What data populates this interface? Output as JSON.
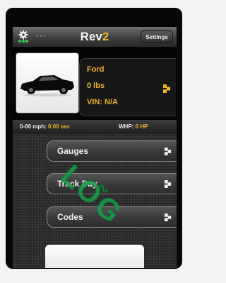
{
  "header": {
    "dots": "···",
    "title_main": "Rev",
    "title_accent": "2",
    "settings_label": "Settings"
  },
  "vehicle": {
    "make": "Ford",
    "weight": "0 lbs",
    "vin": "VIN: N/A"
  },
  "stats": {
    "accel_label": "0-60 mph:",
    "accel_value": "0.00 sec",
    "power_label": "WHP:",
    "power_value": "0 HP"
  },
  "menu": [
    {
      "label": "Gauges"
    },
    {
      "label": "Track Day"
    },
    {
      "label": "Codes"
    }
  ],
  "watermark": "LO֮G",
  "colors": {
    "accent": "#f0b22a",
    "icon_green": "#3cc14d",
    "watermark": "#1aa24a"
  },
  "icons": {
    "gear": "gear-icon",
    "chevron": "chevron-right-icon"
  }
}
